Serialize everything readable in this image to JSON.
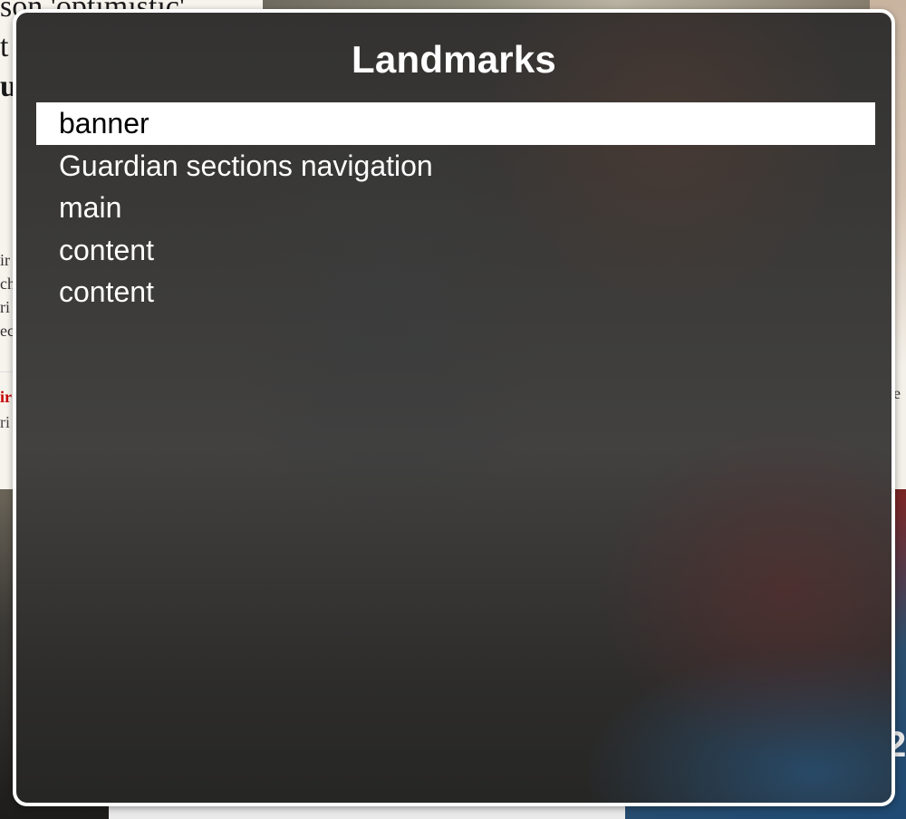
{
  "background": {
    "headline_lines": [
      "son 'optimistic'",
      "t",
      "u"
    ],
    "snippet_lines": [
      "ir",
      "ch",
      "ri",
      "ec"
    ],
    "kicker": {
      "red": "ir",
      "grey": "ri"
    },
    "right_text": "e",
    "big_number": "2"
  },
  "rotor": {
    "title": "Landmarks",
    "items": [
      {
        "label": "banner",
        "selected": true
      },
      {
        "label": "Guardian sections navigation",
        "selected": false
      },
      {
        "label": "main",
        "selected": false
      },
      {
        "label": "content",
        "selected": false
      },
      {
        "label": "content",
        "selected": false
      }
    ]
  }
}
